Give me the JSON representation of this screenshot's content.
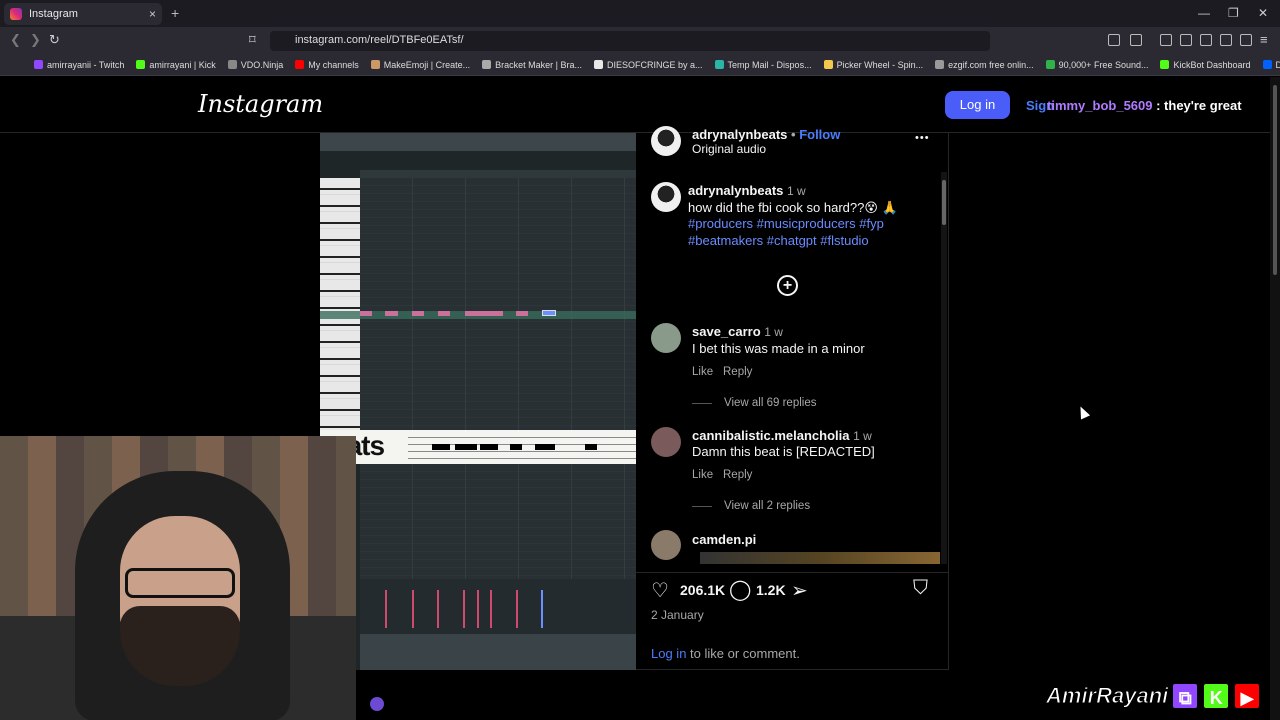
{
  "browser": {
    "tab_title": "Instagram",
    "tab_close": "×",
    "new_tab": "+",
    "url": "instagram.com/reel/DTBFe0EATsf/",
    "win_minimize": "—",
    "win_restore": "❐",
    "win_close": "✕",
    "bookmarks": [
      {
        "label": "amirrayanii - Twitch",
        "color": "#9146ff"
      },
      {
        "label": "amirrayani | Kick",
        "color": "#53fc18"
      },
      {
        "label": "VDO.Ninja",
        "color": "#888888"
      },
      {
        "label": "My channels",
        "color": "#ff0000"
      },
      {
        "label": "MakeEmoji | Create...",
        "color": "#cc9966"
      },
      {
        "label": "Bracket Maker | Bra...",
        "color": "#aaaaaa"
      },
      {
        "label": "DIESOFCRINGE by a...",
        "color": "#e8e8e8"
      },
      {
        "label": "Temp Mail - Dispos...",
        "color": "#2bb5a8"
      },
      {
        "label": "Picker Wheel - Spin...",
        "color": "#f2c94c"
      },
      {
        "label": "ezgif.com free onlin...",
        "color": "#999999"
      },
      {
        "label": "90,000+ Free Sound...",
        "color": "#2fb24a"
      },
      {
        "label": "KickBot Dashboard",
        "color": "#53fc18"
      },
      {
        "label": "Dropbox",
        "color": "#0061ff"
      }
    ]
  },
  "instagram": {
    "logo": "Instagram",
    "login_label": "Log in",
    "signup_label": "Sign",
    "post": {
      "author": "adrynalynbeats",
      "follow_sep": "•",
      "follow_label": "Follow",
      "audio": "Original audio",
      "more": "•••",
      "caption_author": "adrynalynbeats",
      "caption_ago": "1 w",
      "caption_text": "how did the fbi cook so hard??😵 🙏",
      "hashtags_line1": "#producers #musicproducers #fyp",
      "hashtags_line2": "#beatmakers #chatgpt #flstudio",
      "add_symbol": "+"
    },
    "comments": [
      {
        "user": "save_carro",
        "ago": "1 w",
        "text": "I bet this was made in a minor",
        "like": "Like",
        "reply": "Reply",
        "view_replies": "View all 69 replies"
      },
      {
        "user": "cannibalistic.melancholia",
        "ago": "1 w",
        "text": "Damn this beat is [REDACTED]",
        "like": "Like",
        "reply": "Reply",
        "view_replies": "View all 2 replies"
      },
      {
        "user": "camden.pi",
        "ago": "",
        "text": "",
        "like": "",
        "reply": "",
        "view_replies": ""
      }
    ],
    "actions": {
      "likes": "206.1K",
      "comments": "1.2K",
      "date": "2 January",
      "login_link": "Log in",
      "login_suffix": " to like or comment."
    }
  },
  "reel_overlay": {
    "beats_text": "eats"
  },
  "chat_overlay": {
    "user": "timmy_bob_5609",
    "message": " : they're great"
  },
  "stream_brand": {
    "name": "AmirRayani",
    "twitch_color": "#9146ff",
    "kick_color": "#53fc18",
    "youtube_color": "#ff0000"
  },
  "colors": {
    "instagram_blue": "#4a5df9",
    "link_blue": "#6a8cff",
    "chat_user_purple": "#b07cff"
  }
}
